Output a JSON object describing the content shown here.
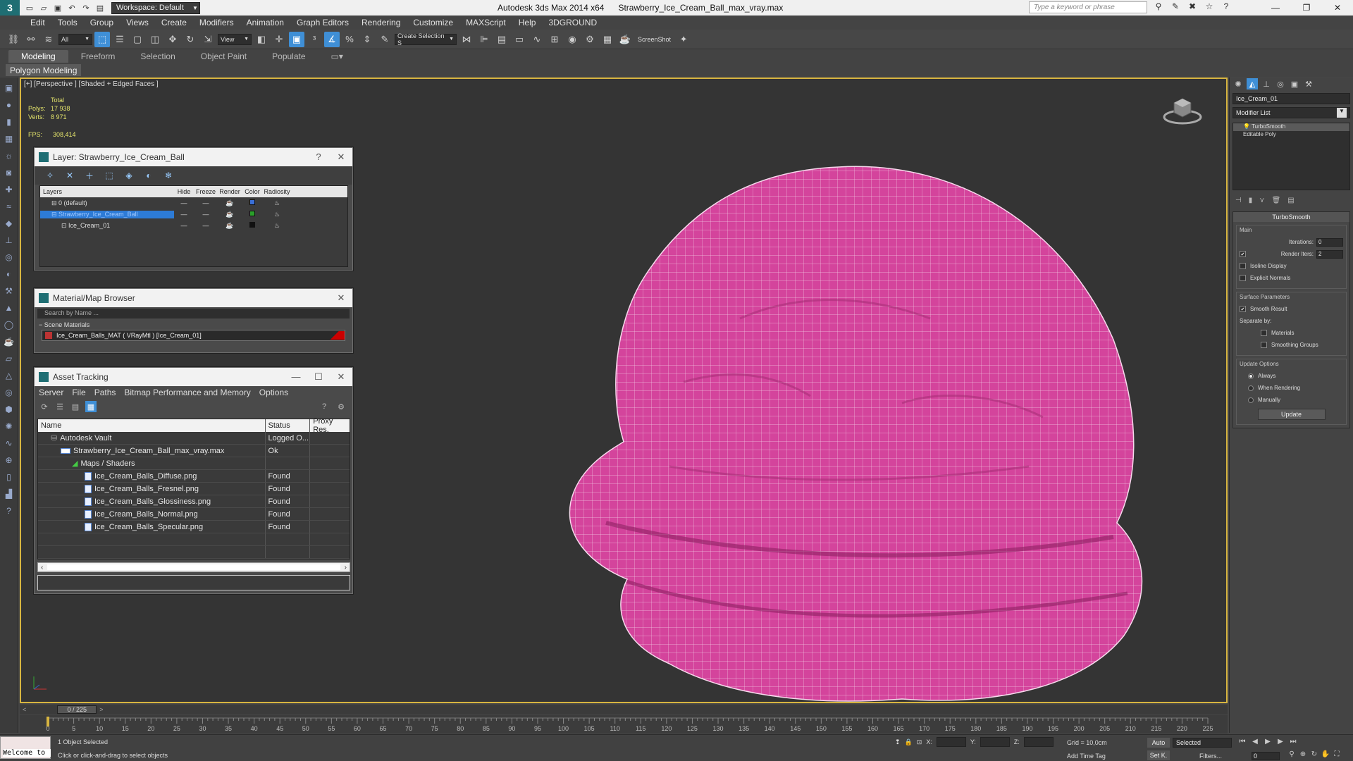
{
  "window": {
    "app_title": "Autodesk 3ds Max  2014 x64",
    "file_title": "Strawberry_Ice_Cream_Ball_max_vray.max",
    "workspace_label": "Workspace: Default",
    "search_placeholder": "Type a keyword or phrase"
  },
  "menu": [
    "Edit",
    "Tools",
    "Group",
    "Views",
    "Create",
    "Modifiers",
    "Animation",
    "Graph Editors",
    "Rendering",
    "Customize",
    "MAXScript",
    "Help",
    "3DGROUND"
  ],
  "toolbar": {
    "filter_value": "All",
    "ref_coord_value": "View",
    "selection_set_placeholder": "Create Selection S",
    "screenshot_label": "ScreenShot"
  },
  "ribbon": {
    "tabs": [
      "Modeling",
      "Freeform",
      "Selection",
      "Object Paint",
      "Populate"
    ],
    "subpanel": "Polygon Modeling"
  },
  "viewport": {
    "label": "[+] [Perspective ] [Shaded + Edged Faces ]",
    "stats_header": "Total",
    "polys_label": "Polys:",
    "polys_value": "17 938",
    "verts_label": "Verts:",
    "verts_value": "8 971",
    "fps_label": "FPS:",
    "fps_value": "308,414",
    "mesh_color": "#d4449c",
    "border_color": "#d7b540"
  },
  "layer_dialog": {
    "title": "Layer: Strawberry_Ice_Cream_Ball",
    "columns": [
      "Layers",
      "Hide",
      "Freeze",
      "Render",
      "Color",
      "Radiosity"
    ],
    "rows": [
      {
        "name": "0 (default)",
        "color": "#3a6fd8"
      },
      {
        "name": "Strawberry_Ice_Cream_Ball",
        "color": "#2aa02a"
      },
      {
        "name": "Ice_Cream_01",
        "color": "#111111"
      }
    ]
  },
  "material_browser": {
    "title": "Material/Map Browser",
    "search_placeholder": "Search by Name ...",
    "category": "Scene Materials",
    "material": "Ice_Cream_Balls_MAT  ( VRayMtl )  [Ice_Cream_01]"
  },
  "asset_tracking": {
    "title": "Asset Tracking",
    "menu": [
      "Server",
      "File",
      "Paths",
      "Bitmap Performance and Memory",
      "Options"
    ],
    "columns": [
      "Name",
      "Status",
      "Proxy Res."
    ],
    "rows": [
      {
        "name": "Autodesk Vault",
        "status": "Logged O..."
      },
      {
        "name": "Strawberry_Ice_Cream_Ball_max_vray.max",
        "status": "Ok"
      },
      {
        "name": "Maps / Shaders",
        "status": ""
      },
      {
        "name": "Ice_Cream_Balls_Diffuse.png",
        "status": "Found"
      },
      {
        "name": "Ice_Cream_Balls_Fresnel.png",
        "status": "Found"
      },
      {
        "name": "Ice_Cream_Balls_Glossiness.png",
        "status": "Found"
      },
      {
        "name": "Ice_Cream_Balls_Normal.png",
        "status": "Found"
      },
      {
        "name": "Ice_Cream_Balls_Specular.png",
        "status": "Found"
      }
    ]
  },
  "command_panel": {
    "object_name": "Ice_Cream_01",
    "modifier_list": "Modifier List",
    "stack": [
      "TurboSmooth",
      "Editable Poly"
    ],
    "rollout_title": "TurboSmooth",
    "main_label": "Main",
    "iterations_label": "Iterations:",
    "iterations_value": "0",
    "render_iters_label": "Render Iters:",
    "render_iters_value": "2",
    "isoline_label": "Isoline Display",
    "explicit_normals_label": "Explicit Normals",
    "surface_params_label": "Surface Parameters",
    "smooth_result_label": "Smooth Result",
    "separate_by_label": "Separate by:",
    "materials_label": "Materials",
    "smoothing_groups_label": "Smoothing Groups",
    "update_options_label": "Update Options",
    "always_label": "Always",
    "when_rendering_label": "When Rendering",
    "manually_label": "Manually",
    "update_button": "Update"
  },
  "timeline": {
    "slider_label": "0 / 225",
    "ticks": [
      0,
      5,
      10,
      15,
      20,
      25,
      30,
      35,
      40,
      45,
      50,
      55,
      60,
      65,
      70,
      75,
      80,
      85,
      90,
      95,
      100,
      105,
      110,
      115,
      120,
      125,
      130,
      135,
      140,
      145,
      150,
      155,
      160,
      165,
      170,
      175,
      180,
      185,
      190,
      195,
      200,
      205,
      210,
      215,
      220,
      225
    ]
  },
  "status": {
    "maxscript_label": "Welcome to",
    "selection_text": "1 Object Selected",
    "prompt_text": "Click or click-and-drag to select objects",
    "x_label": "X:",
    "y_label": "Y:",
    "z_label": "Z:",
    "grid_text": "Grid = 10,0cm",
    "add_time_tag": "Add Time Tag",
    "auto_label": "Auto",
    "setk_label": "Set K.",
    "selected_value": "Selected",
    "filters_label": "Filters...",
    "frame_value": "0"
  }
}
